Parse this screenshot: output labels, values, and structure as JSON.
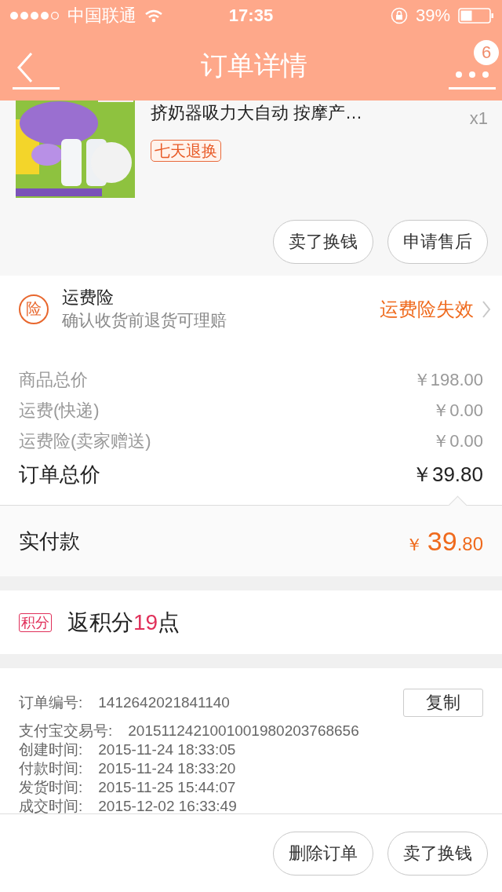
{
  "status_bar": {
    "carrier": "中国联通",
    "time": "17:35",
    "battery": "39%"
  },
  "header": {
    "title": "订单详情",
    "badge": "6"
  },
  "product": {
    "title": "挤奶器吸力大自动 按摩产…",
    "tag": "七天退换",
    "quantity": "x1"
  },
  "product_actions": [
    "卖了换钱",
    "申请售后"
  ],
  "insurance": {
    "icon_label": "险",
    "title": "运费险",
    "subtitle": "确认收货前退货可理赔",
    "status": "运费险失效"
  },
  "price_rows": [
    {
      "kind": "minor",
      "label": "商品总价",
      "value": "￥198.00"
    },
    {
      "kind": "minor",
      "label": "运费(快递)",
      "value": "￥0.00"
    },
    {
      "kind": "minor",
      "label": "运费险(卖家赠送)",
      "value": "￥0.00"
    },
    {
      "kind": "total",
      "label": "订单总价",
      "value": "￥39.80"
    }
  ],
  "paid": {
    "label": "实付款",
    "currency": "￥",
    "integer": "39",
    "decimal": ".80"
  },
  "points": {
    "tag": "积分",
    "prefix": "返积分",
    "amount": "19",
    "suffix": "点"
  },
  "order_info": {
    "number_label": "订单编号:",
    "number": "1412642021841140",
    "copy_button": "复制",
    "rows": [
      {
        "label": "支付宝交易号:",
        "value": "2015112421001001980203768656"
      },
      {
        "label": "创建时间:",
        "value": "2015-11-24 18:33:05"
      },
      {
        "label": "付款时间:",
        "value": "2015-11-24 18:33:20"
      },
      {
        "label": "发货时间:",
        "value": "2015-11-25 15:44:07"
      },
      {
        "label": "成交时间:",
        "value": "2015-12-02 16:33:49"
      }
    ]
  },
  "bottom_actions": [
    "删除订单",
    "卖了换钱"
  ]
}
